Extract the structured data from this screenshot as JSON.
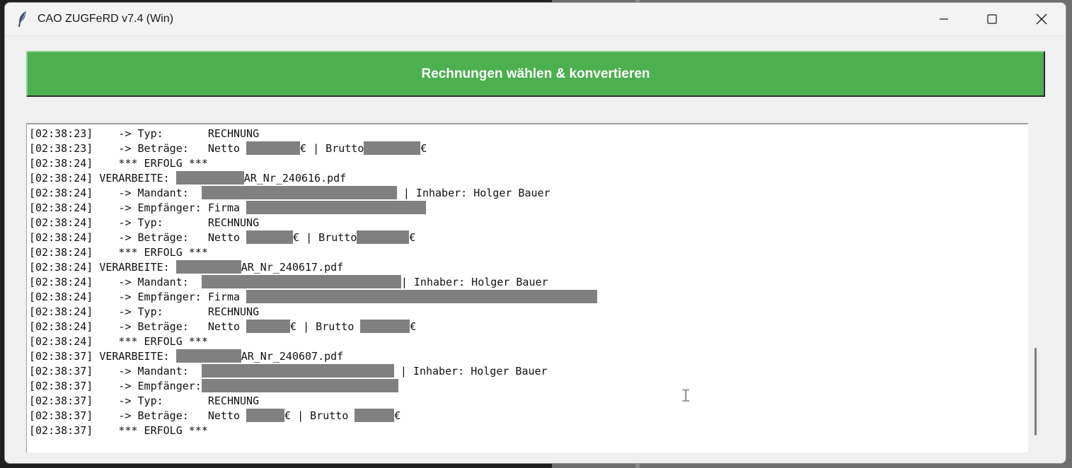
{
  "window": {
    "title": "CAO ZUGFeRD v7.4 (Win)",
    "controls": {
      "minimize_icon": "minimize-icon",
      "maximize_icon": "maximize-icon",
      "close_icon": "close-icon"
    }
  },
  "toolbar": {
    "convert_label": "Rechnungen wählen & konvertieren",
    "convert_color": "#4caf50"
  },
  "log": {
    "lines": [
      {
        "t": "[02:38:23]",
        "parts": [
          {
            "text": "    -> Typ:       RECHNUNG"
          }
        ]
      },
      {
        "t": "[02:38:23]",
        "parts": [
          {
            "text": "    -> Beträge:   Netto "
          },
          {
            "redact": 76
          },
          {
            "text": "€ | Brutto"
          },
          {
            "redact": 80
          },
          {
            "text": "€"
          }
        ]
      },
      {
        "t": "[02:38:24]",
        "parts": [
          {
            "text": "    *** ERFOLG ***"
          }
        ]
      },
      {
        "t": "[02:38:24]",
        "parts": [
          {
            "text": " VERARBEITE: "
          },
          {
            "redact": 96
          },
          {
            "text": "AR_Nr_240616.pdf"
          }
        ]
      },
      {
        "t": "[02:38:24]",
        "parts": [
          {
            "text": "    -> Mandant:  "
          },
          {
            "redact": 276
          },
          {
            "text": " | Inhaber: Holger Bauer"
          }
        ]
      },
      {
        "t": "[02:38:24]",
        "parts": [
          {
            "text": "    -> Empfänger: Firma "
          },
          {
            "redact": 254
          }
        ]
      },
      {
        "t": "[02:38:24]",
        "parts": [
          {
            "text": "    -> Typ:       RECHNUNG"
          }
        ]
      },
      {
        "t": "[02:38:24]",
        "parts": [
          {
            "text": "    -> Beträge:   Netto "
          },
          {
            "redact": 66
          },
          {
            "text": "€ | Brutto"
          },
          {
            "redact": 74
          },
          {
            "text": "€"
          }
        ]
      },
      {
        "t": "[02:38:24]",
        "parts": [
          {
            "text": "    *** ERFOLG ***"
          }
        ]
      },
      {
        "t": "[02:38:24]",
        "parts": [
          {
            "text": " VERARBEITE: "
          },
          {
            "redact": 92
          },
          {
            "text": "AR_Nr_240617.pdf"
          }
        ]
      },
      {
        "t": "[02:38:24]",
        "parts": [
          {
            "text": "    -> Mandant:  "
          },
          {
            "redact": 282
          },
          {
            "text": "| Inhaber: Holger Bauer"
          }
        ]
      },
      {
        "t": "[02:38:24]",
        "parts": [
          {
            "text": "    -> Empfänger: Firma "
          },
          {
            "redact": 496
          }
        ]
      },
      {
        "t": "[02:38:24]",
        "parts": [
          {
            "text": "    -> Typ:       RECHNUNG"
          }
        ]
      },
      {
        "t": "[02:38:24]",
        "parts": [
          {
            "text": "    -> Beträge:   Netto "
          },
          {
            "redact": 62
          },
          {
            "text": "€ | Brutto "
          },
          {
            "redact": 70
          },
          {
            "text": "€"
          }
        ]
      },
      {
        "t": "[02:38:24]",
        "parts": [
          {
            "text": "    *** ERFOLG ***"
          }
        ]
      },
      {
        "t": "[02:38:37]",
        "parts": [
          {
            "text": " VERARBEITE: "
          },
          {
            "redact": 92
          },
          {
            "text": "AR_Nr_240607.pdf"
          }
        ]
      },
      {
        "t": "[02:38:37]",
        "parts": [
          {
            "text": "    -> Mandant:  "
          },
          {
            "redact": 272
          },
          {
            "text": " | Inhaber: Holger Bauer"
          }
        ]
      },
      {
        "t": "[02:38:37]",
        "parts": [
          {
            "text": "    -> Empfänger:"
          },
          {
            "redact": 278
          }
        ]
      },
      {
        "t": "[02:38:37]",
        "parts": [
          {
            "text": "    -> Typ:       RECHNUNG"
          }
        ]
      },
      {
        "t": "[02:38:37]",
        "parts": [
          {
            "text": "    -> Beträge:   Netto "
          },
          {
            "redact": 54
          },
          {
            "text": "€ | Brutto "
          },
          {
            "redact": 56
          },
          {
            "text": "€"
          }
        ]
      },
      {
        "t": "[02:38:37]",
        "parts": [
          {
            "text": "    *** ERFOLG ***"
          }
        ]
      }
    ]
  }
}
